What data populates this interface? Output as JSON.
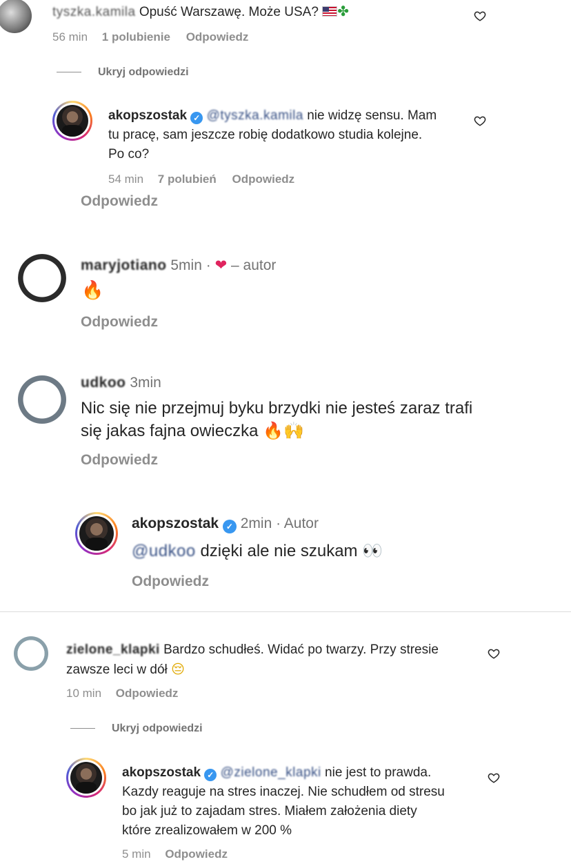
{
  "comments": [
    {
      "username": "tyszka.kamila",
      "text": "Opuść Warszawę. Może USA?",
      "time": "56 min",
      "likes": "1 polubienie",
      "reply": "Odpowiedz",
      "hide_replies": "Ukryj odpowiedzi",
      "replies": [
        {
          "username": "akopszostak",
          "mention": "@tyszka.kamila",
          "text_line1": "nie widzę sensu. Mam",
          "text_line2": "tu pracę, sam jeszcze robię dodatkowo studia kolejne.",
          "text_line3": "Po co?",
          "time": "54 min",
          "likes": "7 polubień",
          "reply": "Odpowiedz"
        }
      ]
    }
  ],
  "reply_big_1": "Odpowiedz",
  "thread2": {
    "username": "maryjotiano",
    "time": "5min ·",
    "author_label": "– autor",
    "reply": "Odpowiedz"
  },
  "thread3": {
    "username": "udkoo",
    "time": "3min",
    "text_line1": "Nic się nie przejmuj byku brzydki nie jesteś  zaraz trafi",
    "text_line2": "się jakas fajna owieczka",
    "reply": "Odpowiedz",
    "reply_item": {
      "username": "akopszostak",
      "time": "2min · Autor",
      "mention": "@udkoo",
      "text": "dzięki ale nie szukam",
      "reply": "Odpowiedz"
    }
  },
  "thread4": {
    "username": "zielone_klapki",
    "text_line1": "Bardzo schudłeś. Widać po twarzy. Przy stresie",
    "text_line2": "zawsze leci w dół",
    "time": "10 min",
    "reply": "Odpowiedz",
    "hide_replies": "Ukryj odpowiedzi",
    "reply_item": {
      "username": "akopszostak",
      "mention": "@zielone_klapki",
      "text_line1": "nie jest to prawda.",
      "text_line2": "Kazdy reaguje na stres inaczej. Nie schudłem od stresu",
      "text_line3": "bo jak już to zajadam stres. Miałem założenia diety",
      "text_line4": "które zrealizowałem w 200 %",
      "time": "5 min",
      "reply": "Odpowiedz"
    }
  },
  "icons": {
    "like": "heart-outline-icon",
    "verified": "verified-badge-icon"
  }
}
